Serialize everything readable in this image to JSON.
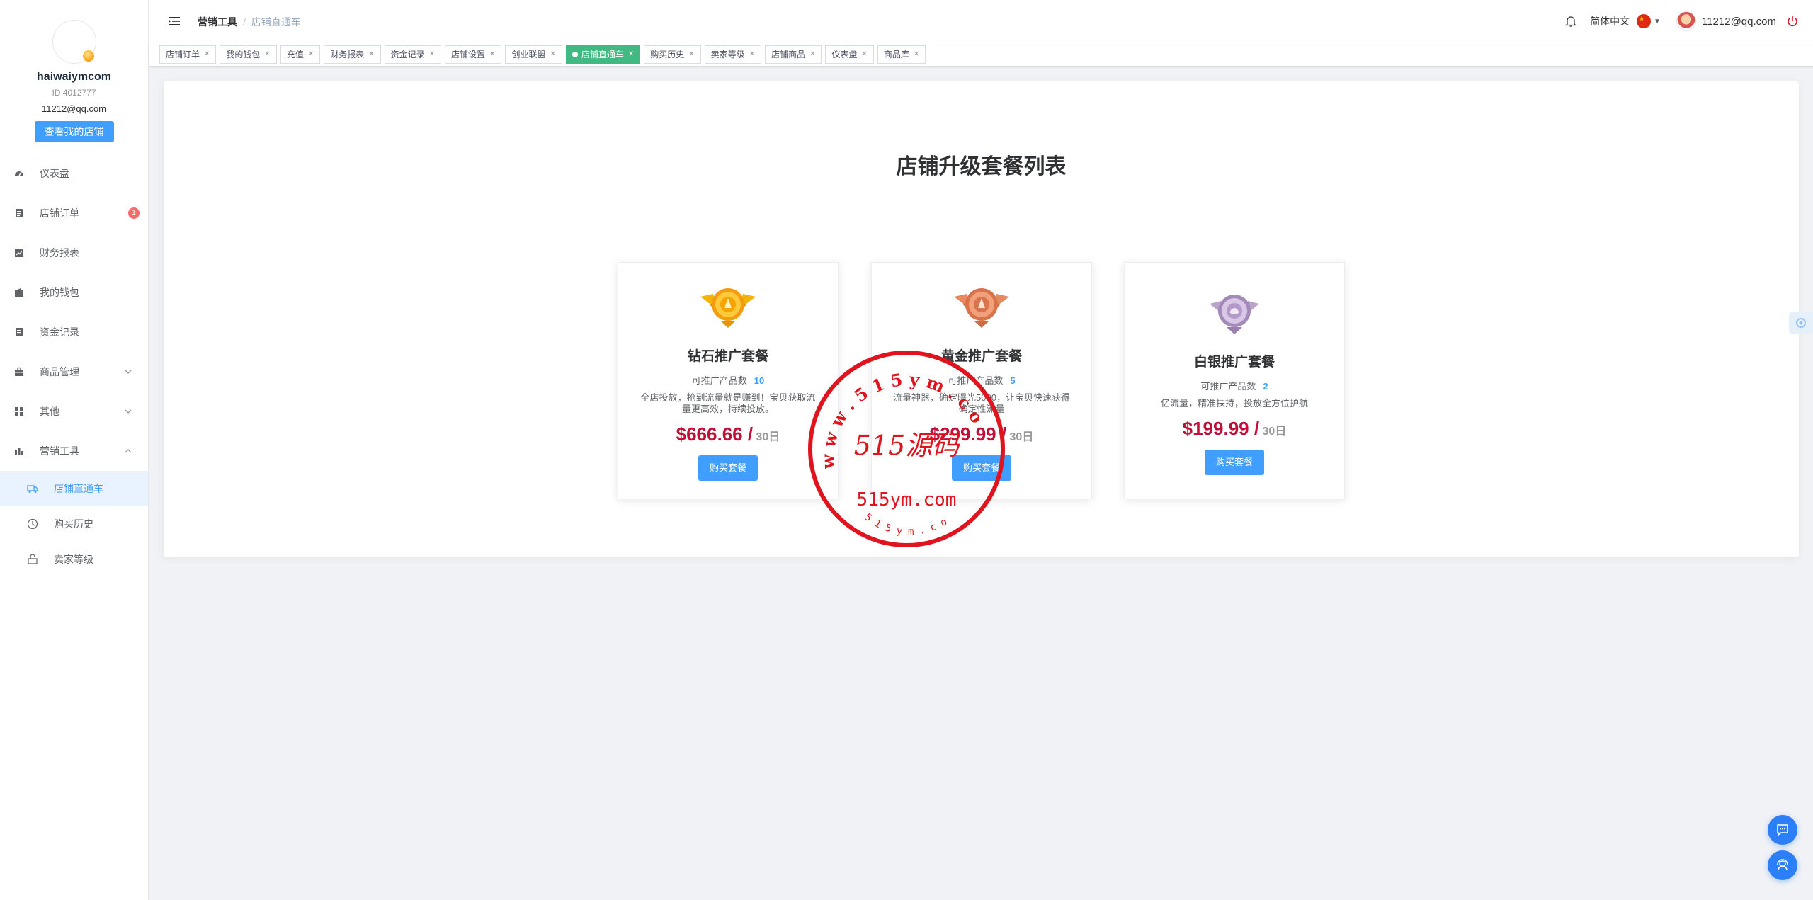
{
  "profile": {
    "username": "haiwaiymcom",
    "id_text": "ID 4012777",
    "email": "11212@qq.com",
    "view_shop_label": "查看我的店铺"
  },
  "sidebar": {
    "items": [
      {
        "label": "仪表盘",
        "icon": "dashboard-icon"
      },
      {
        "label": "店铺订单",
        "icon": "clipboard-icon",
        "badge": "1"
      },
      {
        "label": "财务报表",
        "icon": "chart-icon"
      },
      {
        "label": "我的钱包",
        "icon": "wallet-icon"
      },
      {
        "label": "资金记录",
        "icon": "record-icon"
      },
      {
        "label": "商品管理",
        "icon": "briefcase-icon"
      },
      {
        "label": "其他",
        "icon": "grid-icon"
      },
      {
        "label": "营销工具",
        "icon": "bar-chart-icon"
      }
    ],
    "subitems": [
      {
        "label": "店铺直通车",
        "icon": "truck-icon"
      },
      {
        "label": "购买历史",
        "icon": "clock-icon"
      },
      {
        "label": "卖家等级",
        "icon": "level-icon"
      }
    ]
  },
  "header": {
    "breadcrumb_parent": "营销工具",
    "breadcrumb_separator": "/",
    "breadcrumb_current": "店铺直通车",
    "language": "简体中文",
    "user_email": "11212@qq.com"
  },
  "tags": [
    "店铺订单",
    "我的钱包",
    "充值",
    "财务报表",
    "资金记录",
    "店铺设置",
    "创业联盟",
    "店铺直通车",
    "购买历史",
    "卖家等级",
    "店铺商品",
    "仪表盘",
    "商品库"
  ],
  "active_tag": "店铺直通车",
  "page": {
    "title": "店铺升级套餐列表",
    "plans": [
      {
        "name": "钻石推广套餐",
        "count_label": "可推广产品数",
        "count": "10",
        "desc": "全店投放，抢到流量就是赚到！宝贝获取流量更高效，持续投放。",
        "price": "$666.66 /",
        "unit": "30日",
        "buy_label": "购买套餐"
      },
      {
        "name": "黄金推广套餐",
        "count_label": "可推广产品数",
        "count": "5",
        "desc": "流量神器，确定曝光5000，让宝贝快速获得确定性流量",
        "price": "$299.99 /",
        "unit": "30日",
        "buy_label": "购买套餐"
      },
      {
        "name": "白银推广套餐",
        "count_label": "可推广产品数",
        "count": "2",
        "desc": "亿流量，精准扶持，投放全方位护航",
        "price": "$199.99 /",
        "unit": "30日",
        "buy_label": "购买套餐"
      }
    ]
  },
  "watermark": {
    "ring_text": "w w w . 5 1 5 y m . c o m",
    "center_text": "515源码",
    "domain_text": "515ym.com",
    "bottom_text": "5 1 5 y m . c o m"
  },
  "colors": {
    "primary": "#409eff",
    "active_tag": "#42b983",
    "price": "#c0103a",
    "stamp": "#e0141e"
  }
}
